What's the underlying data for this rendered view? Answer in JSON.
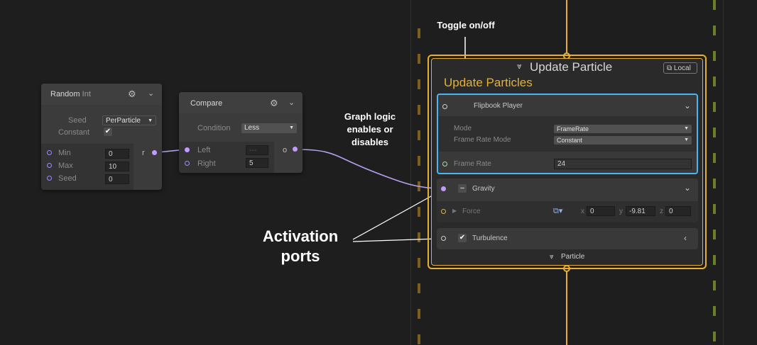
{
  "annotations": {
    "toggle": "Toggle on/off",
    "graph_logic": [
      "Graph logic",
      "enables or",
      "disables"
    ],
    "activation": [
      "Activation",
      "ports"
    ]
  },
  "random_node": {
    "title": "Random",
    "type": "Int",
    "seed_label": "Seed",
    "seed_value": "PerParticle",
    "constant_label": "Constant",
    "constant_checked": "✔",
    "min_label": "Min",
    "min_value": "0",
    "max_label": "Max",
    "max_value": "10",
    "seed2_label": "Seed",
    "seed2_value": "0",
    "out_label": "r"
  },
  "compare_node": {
    "title": "Compare",
    "condition_label": "Condition",
    "condition_value": "Less",
    "left_label": "Left",
    "left_value": "---",
    "right_label": "Right",
    "right_value": "5",
    "out_label": "o"
  },
  "context": {
    "title": "Update Particle",
    "local_label": "Local",
    "subtitle": "Update Particles",
    "footer": "Particle"
  },
  "flipbook": {
    "title": "Flipbook Player",
    "mode_label": "Mode",
    "mode_value": "FrameRate",
    "frame_rate_mode_label": "Frame Rate Mode",
    "frame_rate_mode_value": "Constant",
    "frame_rate_label": "Frame Rate",
    "frame_rate_value": "24"
  },
  "gravity": {
    "title": "Gravity",
    "force_label": "Force",
    "x_label": "x",
    "x_value": "0",
    "y_label": "y",
    "y_value": "-9.81",
    "z_label": "z",
    "z_value": "0"
  },
  "turbulence": {
    "title": "Turbulence"
  },
  "colors": {
    "flow": "#e8b030",
    "selection": "#4ab5f0",
    "edge": "#b8a0f0",
    "port": "#c39bff"
  }
}
